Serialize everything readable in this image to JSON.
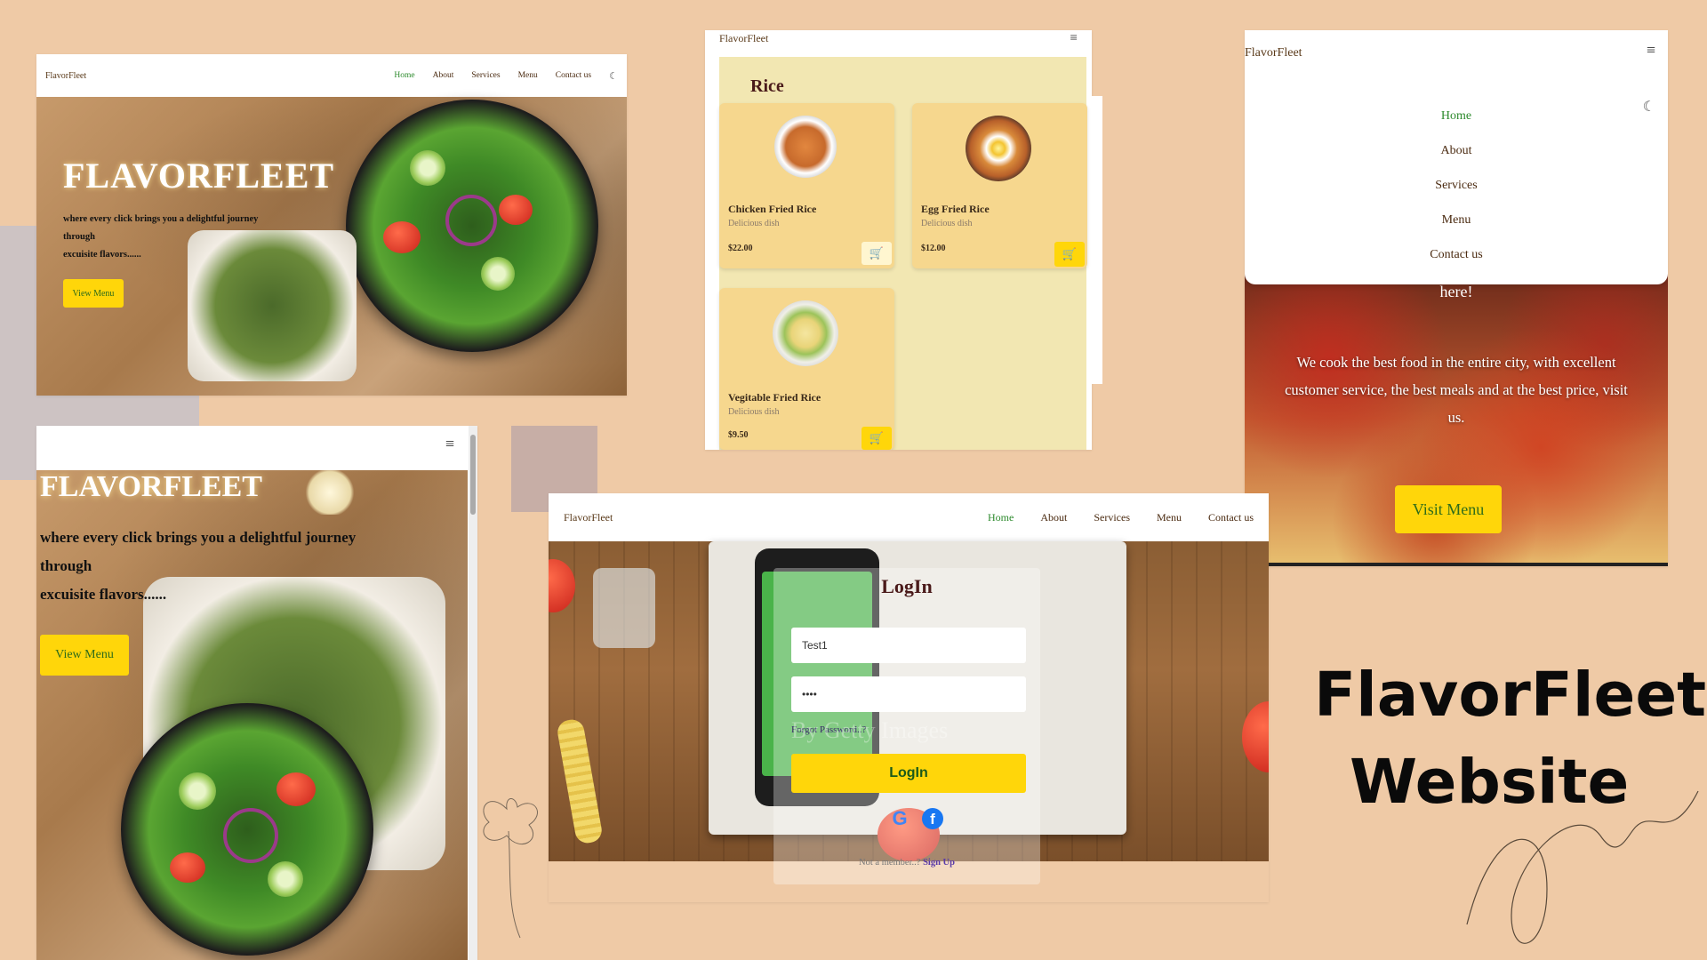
{
  "colors": {
    "background": "#efcaa6",
    "accent_yellow": "#ffd60a",
    "nav_active": "#2e8b2e",
    "card_bg": "#f6d78e",
    "rice_bg": "#f2e7b2"
  },
  "panel_desktop": {
    "brand": "FlavorFleet",
    "nav": [
      "Home",
      "About",
      "Services",
      "Menu",
      "Contact us"
    ],
    "theme_icon": "moon-icon",
    "hero_title": "FLAVORFLEET",
    "hero_text_1": "where every click brings you a delightful journey",
    "hero_text_2": "through",
    "hero_text_3": "excuisite flavors......",
    "cta": "View Menu"
  },
  "panel_rice": {
    "brand": "FlavorFleet",
    "menu_icon": "hamburger-icon",
    "section_title": "Rice",
    "items": [
      {
        "name": "Chicken Fried Rice",
        "desc": "Delicious dish",
        "price": "$22.00"
      },
      {
        "name": "Egg Fried Rice",
        "desc": "Delicious dish",
        "price": "$12.00"
      },
      {
        "name": "Vegitable Fried Rice",
        "desc": "Delicious dish",
        "price": "$9.50"
      }
    ]
  },
  "panel_mobile_nav": {
    "brand": "FlavorFleet",
    "menu_icon": "hamburger-icon",
    "items": [
      "Home",
      "About",
      "Services",
      "Menu",
      "Contact us"
    ],
    "theme_icon": "moon-icon",
    "hero_line": "here!",
    "hero_text_1": "We cook the best food in the entire city, with excellent",
    "hero_text_2": "customer service, the best meals and at the best price, visit",
    "hero_text_3": "us.",
    "cta": "Visit Menu"
  },
  "panel_tablet": {
    "menu_icon": "hamburger-icon",
    "hero_title": "FLAVORFLEET",
    "hero_text_1": "where every click brings you a delightful journey",
    "hero_text_2": "through",
    "hero_text_3": "excuisite flavors......",
    "cta": "View Menu"
  },
  "panel_login": {
    "brand": "FlavorFleet",
    "nav": [
      "Home",
      "About",
      "Services",
      "Menu",
      "Contact us"
    ],
    "title": "LogIn",
    "username_value": "Test1",
    "password_value": "••••",
    "forgot": "Forgot Password..?",
    "submit": "LogIn",
    "not_member": "Not a member..?",
    "signup": "Sign Up",
    "watermark": "By Getty Images"
  },
  "headline": {
    "line1": "FlavorFleet",
    "line2": "Website"
  }
}
